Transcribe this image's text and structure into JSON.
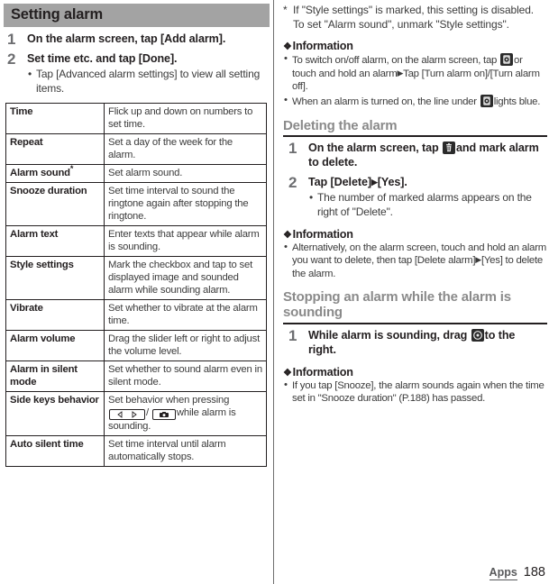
{
  "left": {
    "band_title": "Setting alarm",
    "steps": [
      {
        "num": "1",
        "title": "On the alarm screen, tap [Add alarm].",
        "subs": []
      },
      {
        "num": "2",
        "title": "Set time etc. and tap [Done].",
        "subs": [
          "Tap [Advanced alarm settings] to view all setting items."
        ]
      }
    ],
    "table": {
      "rows": [
        {
          "key": "Time",
          "asterisk": "",
          "value": "Flick up and down on numbers to set time."
        },
        {
          "key": "Repeat",
          "asterisk": "",
          "value": "Set a day of the week for the alarm."
        },
        {
          "key": "Alarm sound",
          "asterisk": "*",
          "value": "Set alarm sound."
        },
        {
          "key": "Snooze duration",
          "asterisk": "",
          "value": "Set time interval to sound the ringtone again after stopping the ringtone."
        },
        {
          "key": "Alarm text",
          "asterisk": "",
          "value": "Enter texts that appear while alarm is sounding."
        },
        {
          "key": "Style settings",
          "asterisk": "",
          "value": "Mark the checkbox and tap to set displayed image and sounded alarm while sounding alarm."
        },
        {
          "key": "Vibrate",
          "asterisk": "",
          "value": "Set whether to vibrate at the alarm time."
        },
        {
          "key": "Alarm volume",
          "asterisk": "",
          "value": "Drag the slider left or right to adjust the volume level."
        },
        {
          "key": "Alarm in silent mode",
          "asterisk": "",
          "value": "Set whether to sound alarm even in silent mode."
        },
        {
          "key": "Side keys behavior",
          "asterisk": "",
          "value_pre": "Set behavior when pressing",
          "icon_volume": "volume-key-icon",
          "value_mid": "/",
          "icon_camera": "camera-key-icon",
          "value_post": "while alarm is sounding."
        },
        {
          "key": "Auto silent time",
          "asterisk": "",
          "value": "Set time interval until alarm automatically stops."
        }
      ]
    }
  },
  "right": {
    "footnote": {
      "marker": "*",
      "text": "If \"Style settings\" is marked, this setting is disabled. To set \"Alarm sound\", unmark \"Style settings\"."
    },
    "info1": {
      "heading": "Information",
      "bullets": [
        {
          "pre": "To switch on/off alarm, on the alarm screen, tap",
          "icon": "alarm-toggle-icon",
          "post": "or touch and hold an alarm",
          "arrow": "▶",
          "tail": "Tap [Turn alarm on]/[Turn alarm off]."
        },
        {
          "pre": "When an alarm is turned on, the line under",
          "icon": "alarm-toggle-icon",
          "post": "lights blue.",
          "arrow": "",
          "tail": ""
        }
      ]
    },
    "section_delete": {
      "heading": "Deleting the alarm",
      "steps": [
        {
          "num": "1",
          "title_pre": "On the alarm screen, tap",
          "icon": "trash-icon",
          "title_post": "and mark alarm to delete.",
          "subs": []
        },
        {
          "num": "2",
          "title_pre": "Tap [Delete]",
          "arrow": "▶",
          "title_post": "[Yes].",
          "subs": [
            "The number of marked alarms appears on the right of \"Delete\"."
          ]
        }
      ]
    },
    "info2": {
      "heading": "Information",
      "bullets": [
        {
          "pre": "Alternatively, on the alarm screen, touch and hold an alarm you want to delete, then tap [Delete alarm]",
          "icon": "",
          "post": "",
          "arrow": "▶",
          "tail": "[Yes] to delete the alarm."
        }
      ]
    },
    "section_stop": {
      "heading": "Stopping an alarm while the alarm is sounding",
      "steps": [
        {
          "num": "1",
          "title_pre": "While alarm is sounding, drag",
          "icon": "alarm-drag-icon",
          "title_post": "to the right.",
          "subs": []
        }
      ]
    },
    "info3": {
      "heading": "Information",
      "bullets": [
        {
          "pre": "If you tap [Snooze], the alarm sounds again when the time set in \"Snooze duration\" (P.188) has passed.",
          "icon": "",
          "post": "",
          "arrow": "",
          "tail": ""
        }
      ]
    }
  },
  "footer": {
    "section_label": "Apps",
    "page_number": "188"
  },
  "colors": {
    "band": "#a3a3a3",
    "heading_gray": "#8a8a8a",
    "step_num": "#6d6e71",
    "body": "#3b3b3b",
    "rule": "#231f20"
  }
}
